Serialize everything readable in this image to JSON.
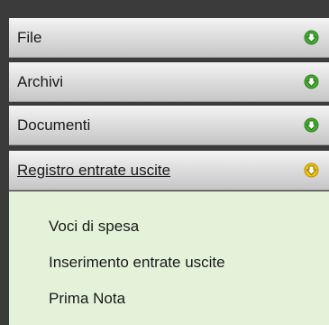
{
  "menu": {
    "sections": [
      {
        "label": "File",
        "icon": "expand-down-arrow-icon",
        "icon_color": "#3fae2a"
      },
      {
        "label": "Archivi",
        "icon": "expand-down-arrow-icon",
        "icon_color": "#3fae2a"
      },
      {
        "label": "Documenti",
        "icon": "expand-down-arrow-icon",
        "icon_color": "#3fae2a"
      },
      {
        "label": "Registro entrate uscite",
        "icon": "expand-down-arrow-icon",
        "icon_color": "#e0b800",
        "expanded": true
      }
    ],
    "items": [
      {
        "label": "Voci di spesa"
      },
      {
        "label": "Inserimento entrate uscite"
      },
      {
        "label": "Prima Nota"
      }
    ]
  },
  "colors": {
    "frame": "#3b3b3b",
    "content_background": "#e5f2da",
    "header_gradient_top": "#f4f4f4",
    "header_gradient_bottom": "#c6c6c6"
  }
}
